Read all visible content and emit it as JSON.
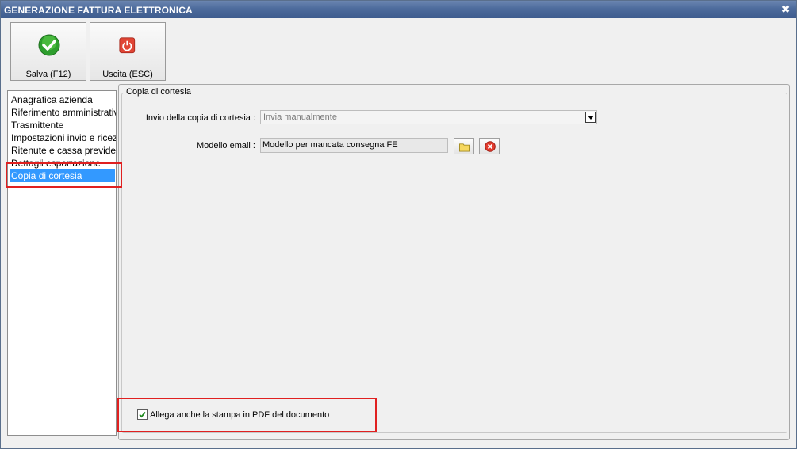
{
  "window": {
    "title": "GENERAZIONE FATTURA ELETTRONICA",
    "close_icon": "close-icon"
  },
  "toolbar": {
    "save_label": "Salva (F12)",
    "exit_label": "Uscita (ESC)",
    "save_icon": "check-icon",
    "exit_icon": "power-icon"
  },
  "sidebar": {
    "items": [
      {
        "label": "Anagrafica azienda"
      },
      {
        "label": "Riferimento amministrativo"
      },
      {
        "label": "Trasmittente"
      },
      {
        "label": "Impostazioni invio e ricezione"
      },
      {
        "label": "Ritenute e cassa previdenziale"
      },
      {
        "label": "Dettagli esportazione"
      },
      {
        "label": "Copia di cortesia",
        "selected": true
      }
    ]
  },
  "section": {
    "title": "Copia di cortesia",
    "invio_label": "Invio della copia di cortesia :",
    "invio_value": "Invia manualmente",
    "modello_label": "Modello email :",
    "modello_value": "Modello per mancata consegna FE",
    "allega_label": "Allega anche la stampa in PDF del documento",
    "allega_checked": true
  },
  "colors": {
    "highlight": "#e02020",
    "selection": "#3399ff",
    "titlebar": "#4d6b9c"
  }
}
